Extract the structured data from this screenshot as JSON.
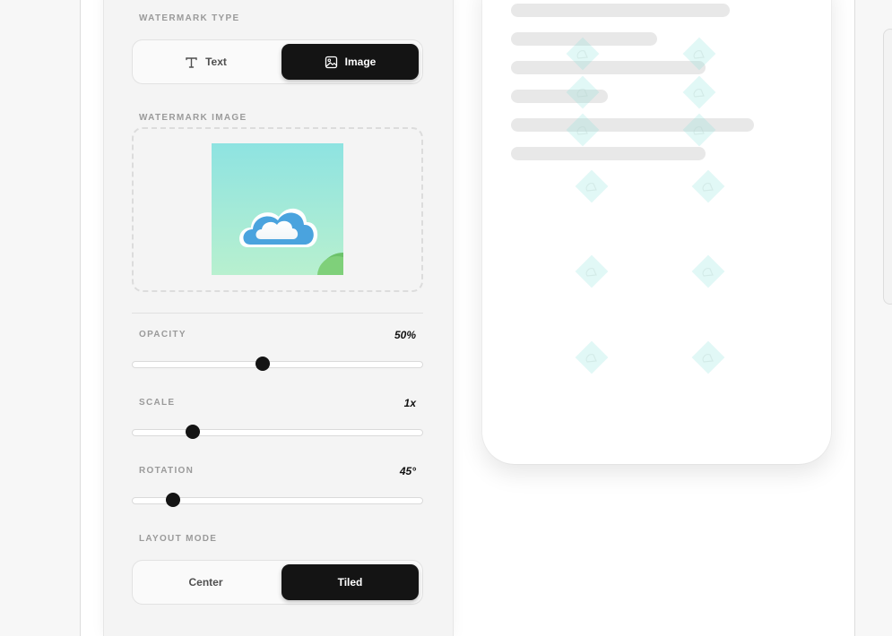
{
  "watermark_type": {
    "label": "WATERMARK TYPE",
    "options": [
      {
        "label": "Text",
        "icon": "text-icon",
        "active": false
      },
      {
        "label": "Image",
        "icon": "image-icon",
        "active": true
      }
    ]
  },
  "watermark_image": {
    "label": "WATERMARK IMAGE",
    "thumbnail": "cloud-image"
  },
  "opacity": {
    "label": "OPACITY",
    "value": "50%",
    "fraction": 0.45
  },
  "scale": {
    "label": "SCALE",
    "value": "1x",
    "fraction": 0.21
  },
  "rotation": {
    "label": "ROTATION",
    "value": "45°",
    "fraction": 0.14
  },
  "layout_mode": {
    "label": "LAYOUT MODE",
    "options": [
      {
        "label": "Center",
        "active": false
      },
      {
        "label": "Tiled",
        "active": true
      }
    ]
  },
  "colors": {
    "accent": "#141414",
    "panel": "#f4f4f4",
    "watermark_tint": "#7fe0d6"
  }
}
